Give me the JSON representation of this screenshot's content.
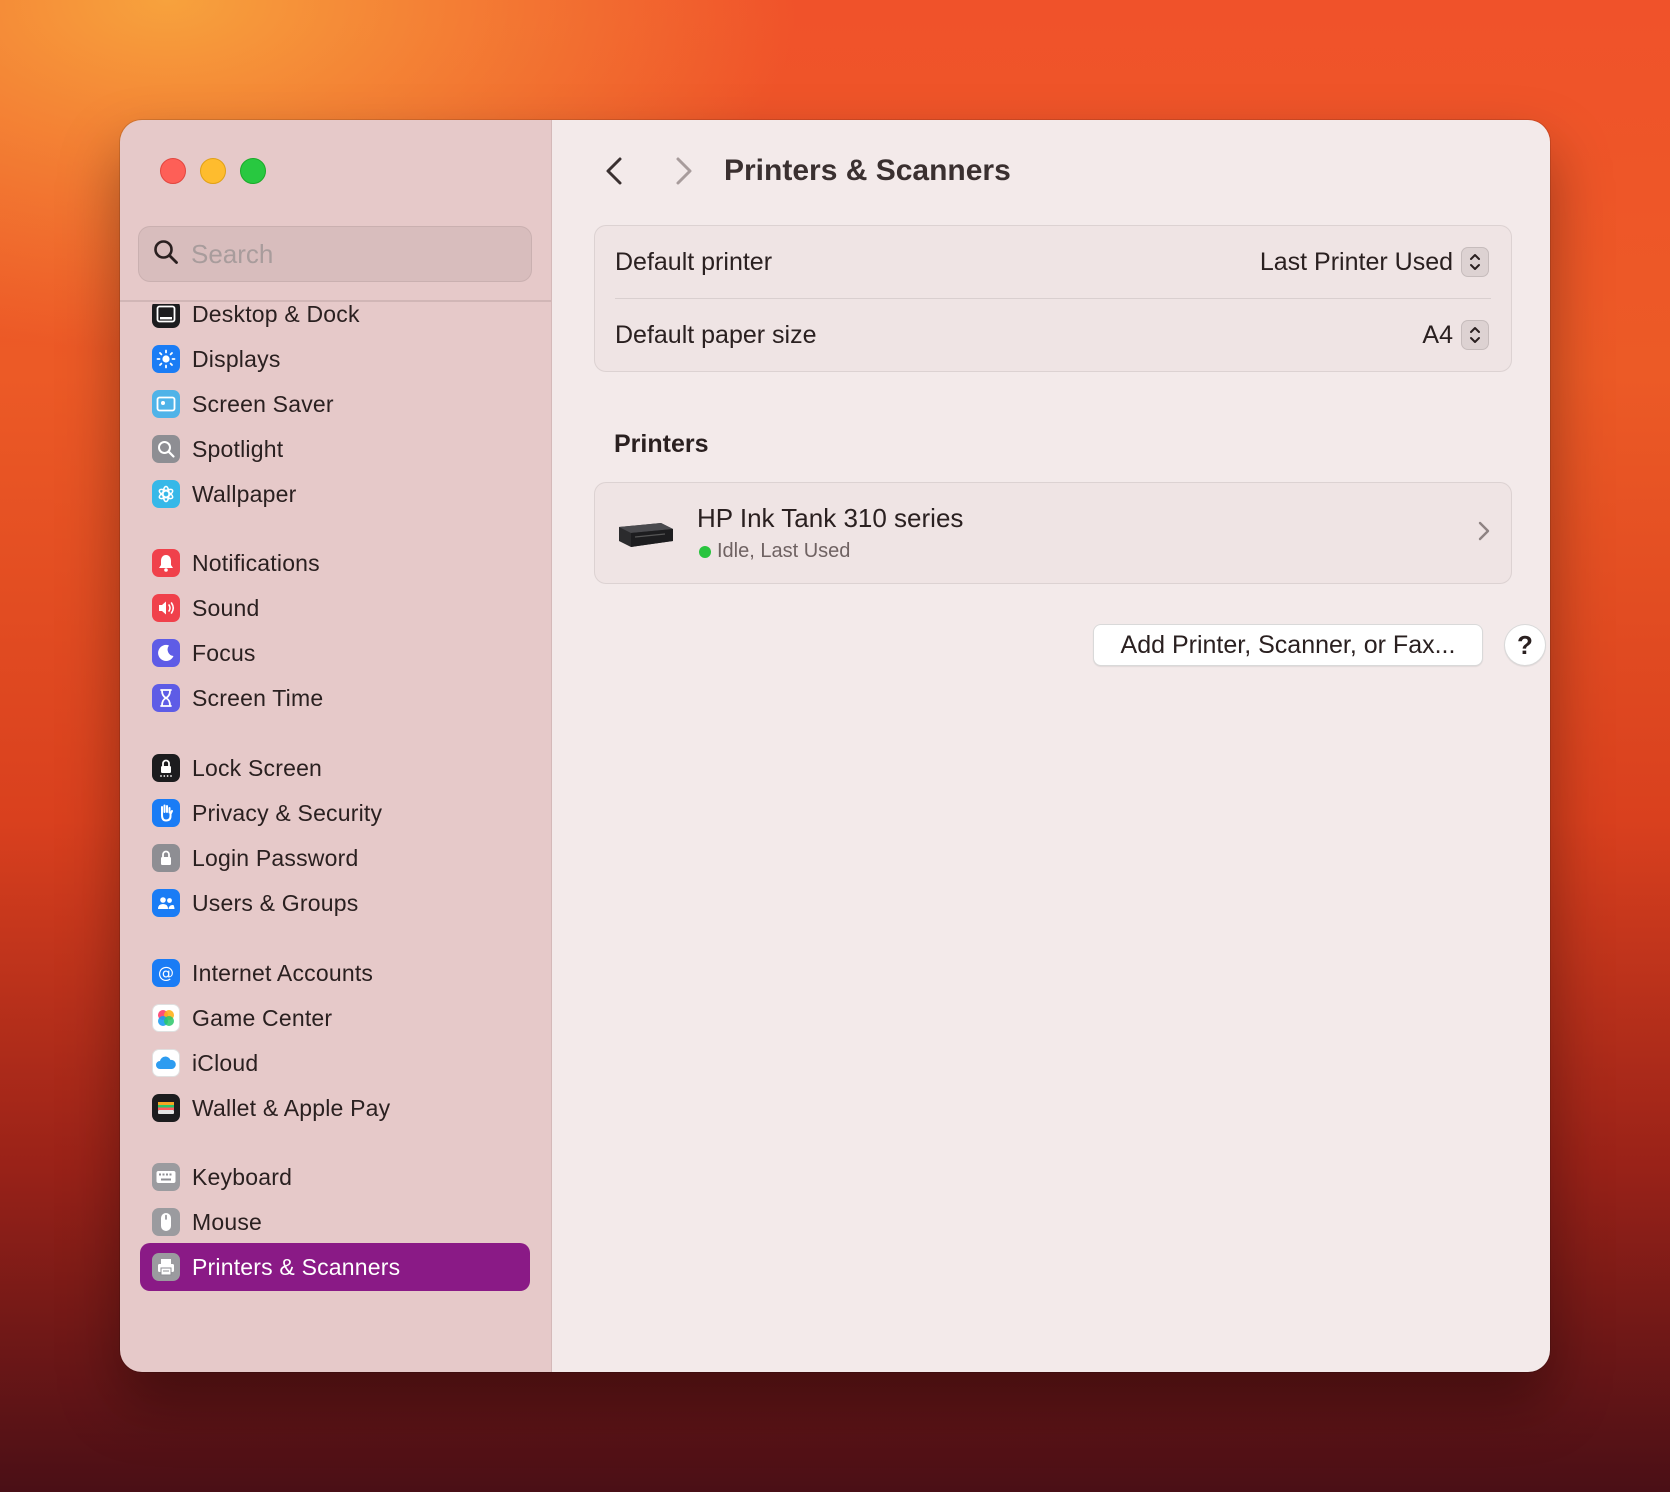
{
  "window": {
    "title": "Printers & Scanners"
  },
  "search": {
    "placeholder": "Search"
  },
  "sidebar": {
    "items": [
      {
        "label": "Desktop & Dock",
        "icon": "desktop-dock-icon",
        "color": "#1c1c1e"
      },
      {
        "label": "Displays",
        "icon": "displays-icon",
        "color": "#1a7cf5"
      },
      {
        "label": "Screen Saver",
        "icon": "screen-saver-icon",
        "color": "#4fb3e8"
      },
      {
        "label": "Spotlight",
        "icon": "spotlight-icon",
        "color": "#8e8e93"
      },
      {
        "label": "Wallpaper",
        "icon": "wallpaper-icon",
        "color": "#36b8e8"
      },
      {
        "label": "Notifications",
        "icon": "notifications-icon",
        "color": "#f0414b"
      },
      {
        "label": "Sound",
        "icon": "sound-icon",
        "color": "#f0414b"
      },
      {
        "label": "Focus",
        "icon": "focus-icon",
        "color": "#5e5ce6"
      },
      {
        "label": "Screen Time",
        "icon": "screen-time-icon",
        "color": "#5e5ce6"
      },
      {
        "label": "Lock Screen",
        "icon": "lock-screen-icon",
        "color": "#1c1c1e"
      },
      {
        "label": "Privacy & Security",
        "icon": "privacy-security-icon",
        "color": "#1a7cf5"
      },
      {
        "label": "Login Password",
        "icon": "login-password-icon",
        "color": "#8e8e93"
      },
      {
        "label": "Users & Groups",
        "icon": "users-groups-icon",
        "color": "#1a7cf5"
      },
      {
        "label": "Internet Accounts",
        "icon": "internet-accounts-icon",
        "color": "#1a7cf5"
      },
      {
        "label": "Game Center",
        "icon": "game-center-icon",
        "color": "#ffffff"
      },
      {
        "label": "iCloud",
        "icon": "icloud-icon",
        "color": "#ffffff"
      },
      {
        "label": "Wallet & Apple Pay",
        "icon": "wallet-icon",
        "color": "#1c1c1e"
      },
      {
        "label": "Keyboard",
        "icon": "keyboard-icon",
        "color": "#9b9b9f"
      },
      {
        "label": "Mouse",
        "icon": "mouse-icon",
        "color": "#9b9b9f"
      },
      {
        "label": "Printers & Scanners",
        "icon": "printers-scanners-icon",
        "color": "#9b9b9f",
        "active": true
      }
    ]
  },
  "main": {
    "title": "Printers & Scanners",
    "defaults": {
      "printer_label": "Default printer",
      "printer_value": "Last Printer Used",
      "paper_label": "Default paper size",
      "paper_value": "A4"
    },
    "printers_heading": "Printers",
    "printer": {
      "name": "HP Ink Tank 310 series",
      "status": "Idle, Last Used",
      "status_color": "#29c43e"
    },
    "add_button": "Add Printer, Scanner, or Fax...",
    "help_button": "?"
  },
  "colors": {
    "accent": "#8a1a86",
    "sidebar_bg": "#e6c9c9",
    "main_bg": "#f3eaea"
  }
}
